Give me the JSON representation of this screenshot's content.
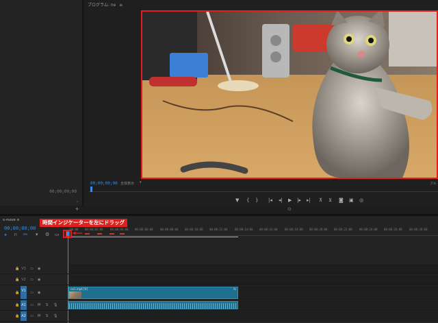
{
  "program": {
    "title": "プログラム: ne",
    "menu_icon": "≡",
    "timecode": "00;00;00;00",
    "fit": "全体表示",
    "full": "フル"
  },
  "source": {
    "timecode": "00;00;00;00"
  },
  "timeline": {
    "tab": "x-move ≡",
    "timecode": "00;00;00;00",
    "ruler": [
      ":00;00",
      "00;00;02;00",
      "00;00;04;00",
      "00;00;06;00",
      "00;00;08;00",
      "00;00;10;00",
      "00;00;12;00",
      "00;00;14;00",
      "00;00;16;00",
      "00;00;18;00",
      "00;00;20;00",
      "00;00;22;00",
      "00;00;24;00",
      "00;00;26;00",
      "00;00;28;00"
    ],
    "callout": "時間インジケーターを左にドラッグ",
    "tracks": [
      {
        "name": "V3",
        "active": false,
        "b1": "▭",
        "b2": "◉"
      },
      {
        "name": "V2",
        "active": false,
        "b1": "▭",
        "b2": "◉"
      },
      {
        "name": "V1",
        "active": true,
        "b1": "▭",
        "b2": "◉"
      },
      {
        "name": "A1",
        "active": true,
        "b1": "▭",
        "b2": "M",
        "b3": "S",
        "b4": "🎙"
      },
      {
        "name": "A2",
        "active": true,
        "b1": "▭",
        "b2": "M",
        "b3": "S",
        "b4": "🎙"
      }
    ],
    "clip_video_name": "ne1.mp4 [V]",
    "clip_fx": "fx"
  },
  "colors": {
    "accent": "#3d8de0",
    "highlight": "#e0201e",
    "clip": "#1f6f8e"
  }
}
